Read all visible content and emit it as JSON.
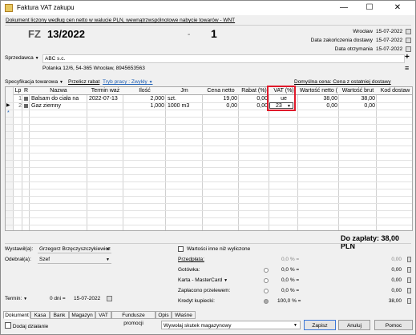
{
  "window": {
    "title": "Faktura VAT zakupu",
    "minimize": "—",
    "maximize": "☐",
    "close": "✕"
  },
  "info_line": "Dokument liczony według cen netto w walucie PLN, wewnątrzwspólnotowe nabycie towarów - WNT",
  "doc": {
    "prefix": "FZ",
    "number": "13/2022",
    "dash": "-",
    "suffix": "1"
  },
  "dates": [
    {
      "label": "Wrocław",
      "value": "15-07-2022"
    },
    {
      "label": "Data zakończenia dostawy",
      "value": "15-07-2022"
    },
    {
      "label": "Data otrzymania",
      "value": "15-07-2022"
    }
  ],
  "seller": {
    "label": "Sprzedawca",
    "name": "ABC s.c.",
    "address": "Polanka 12/6, 54-365 Wrocław, 8945653563",
    "add": "+",
    "menu": "≡"
  },
  "spec": {
    "label": "Specyfikacja towarowa",
    "recalc": "Przelicz rabat",
    "mode": "Tryb pracy : Zwykły",
    "default_price": "Domyślna cena: Cena z ostatniej dostawy"
  },
  "table": {
    "headers": [
      "Lp",
      "R",
      "Nazwa",
      "Termin waż",
      "Ilość",
      "Jm",
      "Cena netto",
      "Rabat (%)",
      "VAT (%)",
      "Wartość netto (",
      "Wartość brut",
      "Kod dostaw"
    ],
    "rows": [
      {
        "lp": "1",
        "nazwa": "Balsam do ciała na",
        "termin": "2022-07-13",
        "ilosc": "2,000",
        "jm": "szt.",
        "cena": "19,00",
        "rabat": "0,00",
        "vat": "ue",
        "netto": "38,00",
        "brutto": "38,00",
        "kod": ""
      },
      {
        "lp": "2",
        "nazwa": "Gaz ziemny",
        "termin": "",
        "ilosc": "1,000",
        "jm": "1000 m3",
        "cena": "0,00",
        "rabat": "0,00",
        "vat": "23",
        "netto": "0,00",
        "brutto": "0,00",
        "kod": ""
      }
    ],
    "new_row_marker": "*",
    "current_row_marker": "▶"
  },
  "total": "Do zapłaty: 38,00 PLN",
  "left": {
    "wystawil_label": "Wystawił(a):",
    "wystawil": "Grzegorz Brzęczyszczykiewicz",
    "odebral_label": "Odebrał(a):",
    "odebral": "Szef",
    "termin_label": "Termin:",
    "termin_days": "0 dni =",
    "termin_date": "15-07-2022"
  },
  "right": {
    "checkbox_label": "Wartości inne niż wyliczone",
    "payments": [
      {
        "label": "Przedpłata:",
        "percent": "0,0 % =",
        "value": "0,00"
      },
      {
        "label": "Gotówka:",
        "percent": "0,0 % =",
        "value": "0,00"
      },
      {
        "label": "Karta - MasterCard",
        "percent": "0,0 % =",
        "value": "0,00"
      },
      {
        "label": "Zapłacono przelewem:",
        "percent": "0,0 % =",
        "value": "0,00"
      },
      {
        "label": "Kredyt kupiecki:",
        "percent": "100,0 % =",
        "value": "38,00"
      }
    ]
  },
  "tabs": [
    "Dokument",
    "Kasa",
    "Bank",
    "Magazyn",
    "VAT",
    "Fundusze promocji",
    "Opis",
    "Właśne"
  ],
  "bottom": {
    "add_label": "Dodaj działanie",
    "select_value": "Wywołaj skutek magazynowy",
    "save": "Zapisz",
    "cancel": "Anuluj",
    "help": "Pomoc"
  }
}
